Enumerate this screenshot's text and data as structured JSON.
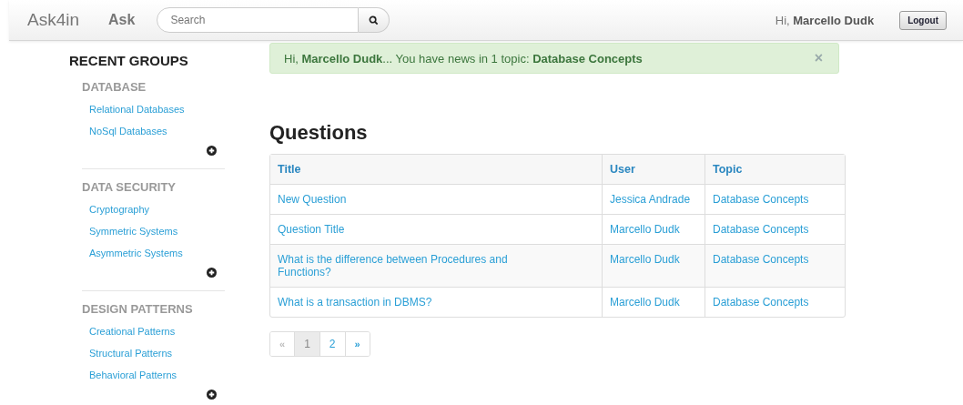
{
  "navbar": {
    "brand": "Ask4in",
    "ask_link": "Ask",
    "search": {
      "placeholder": "Search"
    },
    "greeting": "Hi, **Marcello Dudk**",
    "logout": "Logout"
  },
  "sidebar": {
    "title": "RECENT GROUPS",
    "groups": [
      {
        "name": "DATABASE",
        "items": [
          "Relational Databases",
          "NoSql Databases"
        ]
      },
      {
        "name": "DATA SECURITY",
        "items": [
          "Cryptography",
          "Symmetric Systems",
          "Asymmetric Systems"
        ]
      },
      {
        "name": "DESIGN PATTERNS",
        "items": [
          "Creational Patterns",
          "Structural Patterns",
          "Behavioral Patterns"
        ]
      }
    ]
  },
  "alert": {
    "message": "Hi, **Marcello Dudk**... You have news in 1 topic: **Database Concepts**",
    "close": "×"
  },
  "questions": {
    "heading": "Questions",
    "columns": [
      "Title",
      "User",
      "Topic"
    ],
    "rows": [
      {
        "title": "New Question",
        "user": "Jessica Andrade",
        "topic": "Database Concepts"
      },
      {
        "title": "Question Title",
        "user": "Marcello Dudk",
        "topic": "Database Concepts"
      },
      {
        "title": "What is the difference between Procedures and Functions?",
        "user": "Marcello Dudk",
        "topic": "Database Concepts"
      },
      {
        "title": "What is a transaction in DBMS?",
        "user": "Marcello Dudk",
        "topic": "Database Concepts"
      }
    ]
  },
  "pagination": [
    {
      "label": "«",
      "kind": "prev",
      "disabled": true,
      "selected": false
    },
    {
      "label": "1",
      "kind": "page",
      "disabled": false,
      "selected": true
    },
    {
      "label": "2",
      "kind": "page",
      "disabled": false,
      "selected": false
    },
    {
      "label": "»",
      "kind": "next",
      "disabled": false,
      "selected": false
    }
  ]
}
